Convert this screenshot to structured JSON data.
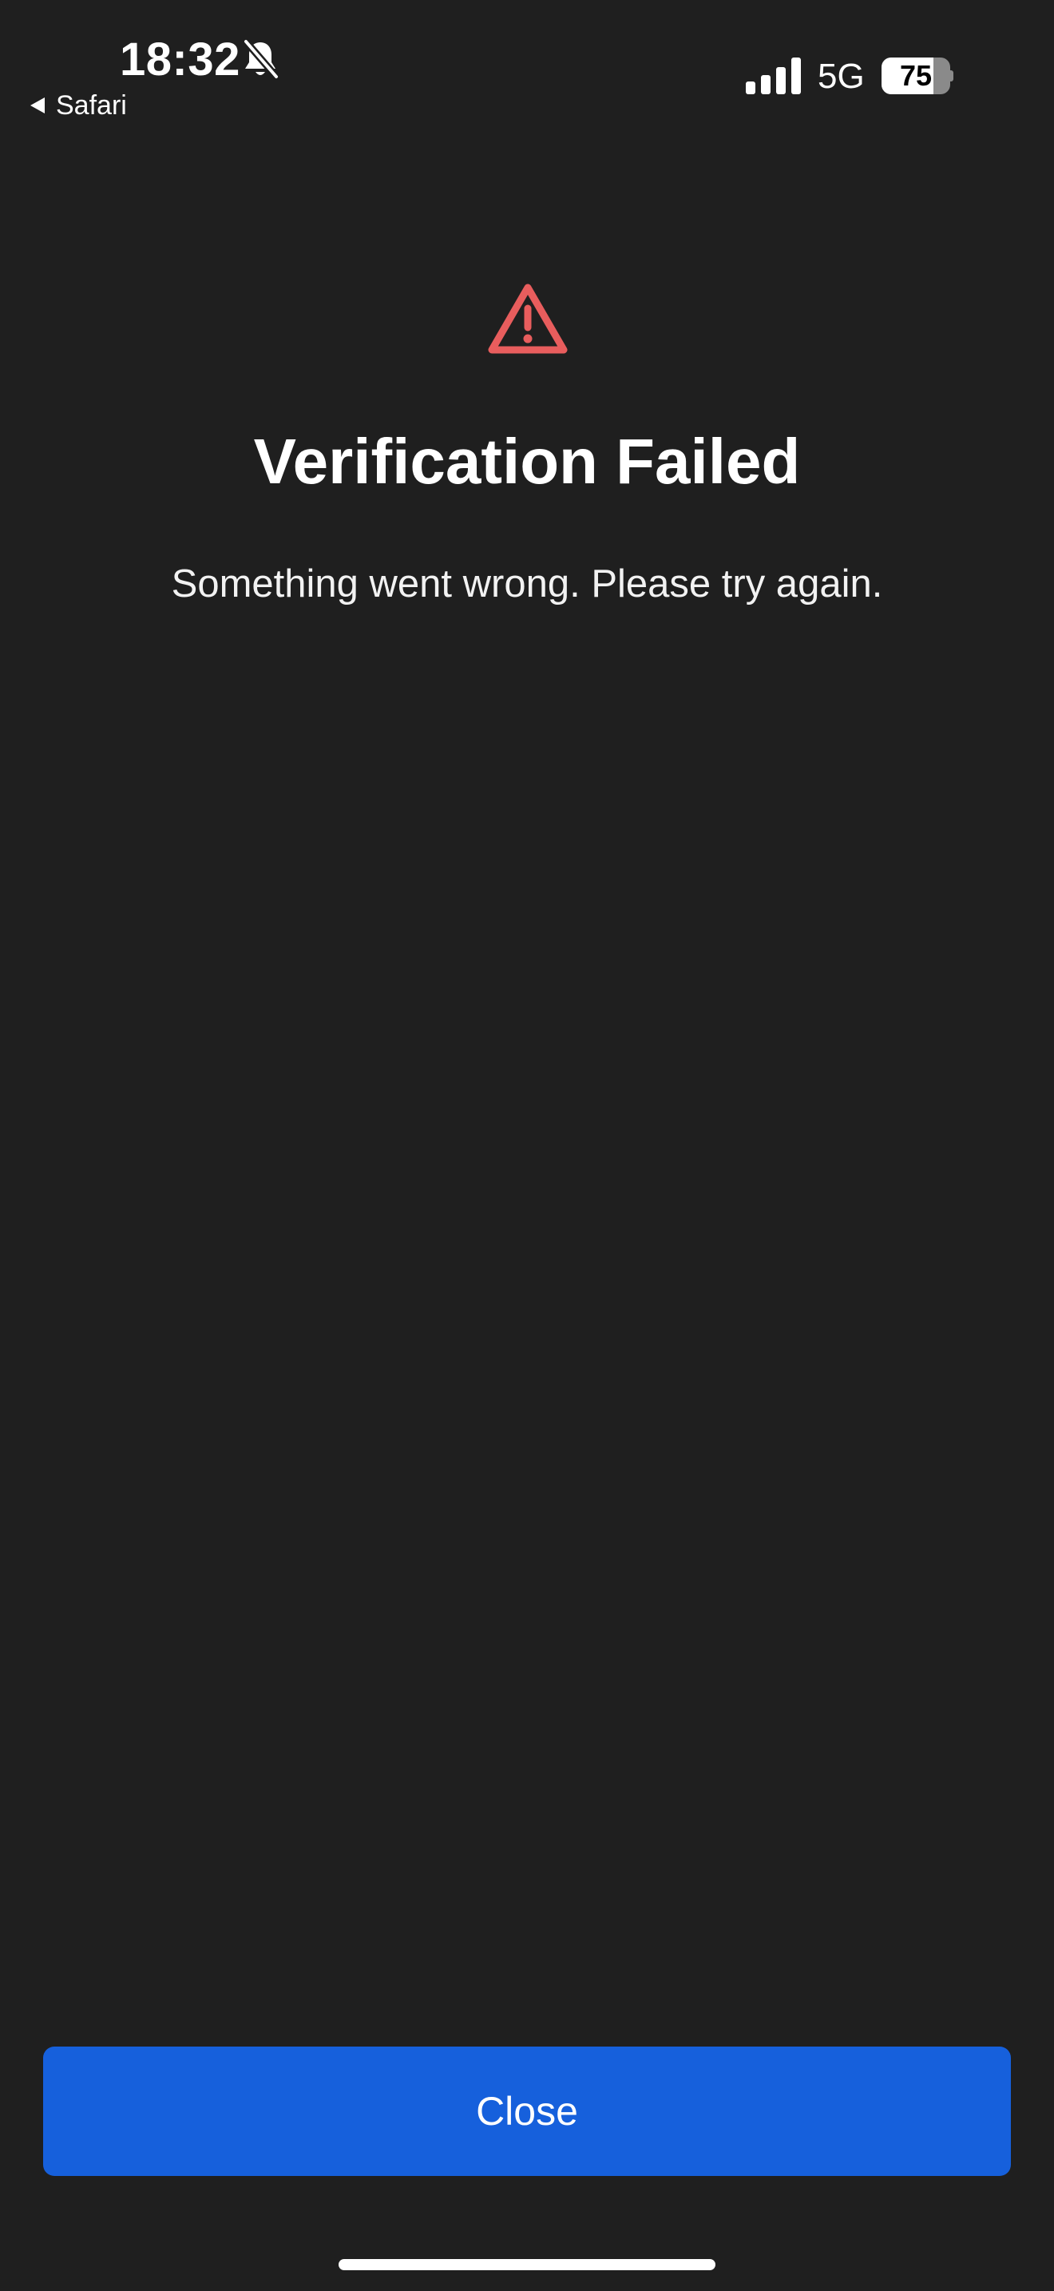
{
  "status_bar": {
    "time": "18:32",
    "back_label": "Safari",
    "network": "5G",
    "battery_level": 75,
    "battery_text": "75",
    "icons": [
      "bell-slash-icon",
      "back-arrow-icon",
      "cellular-signal-icon",
      "battery-icon"
    ]
  },
  "content": {
    "icon": "warning-triangle-icon",
    "title": "Verification Failed",
    "message": "Something went wrong. Please try again."
  },
  "actions": {
    "close_label": "Close"
  },
  "colors": {
    "background": "#1f1f1f",
    "warning": "#e85d5d",
    "button": "#1660dc",
    "text": "#ffffff"
  }
}
